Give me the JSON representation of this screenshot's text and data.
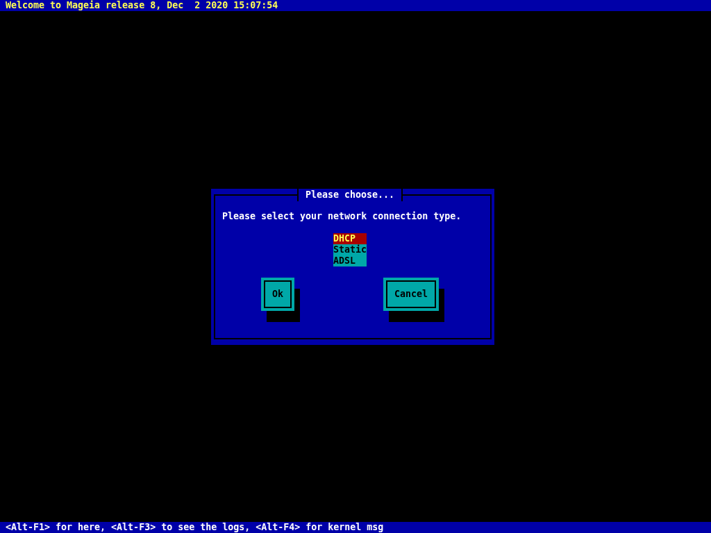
{
  "top_bar": {
    "text": "Welcome to Mageia release 8, Dec  2 2020 15:07:54"
  },
  "dialog": {
    "title": "Please choose...",
    "message": "Please select your network connection type.",
    "options": [
      {
        "label": "DHCP",
        "selected": true
      },
      {
        "label": "Static",
        "selected": false
      },
      {
        "label": "ADSL",
        "selected": false
      }
    ],
    "buttons": [
      "Ok",
      "Cancel"
    ]
  },
  "bottom_bar": {
    "text": "<Alt-F1> for here, <Alt-F3> to see the logs, <Alt-F4> for kernel msg"
  }
}
